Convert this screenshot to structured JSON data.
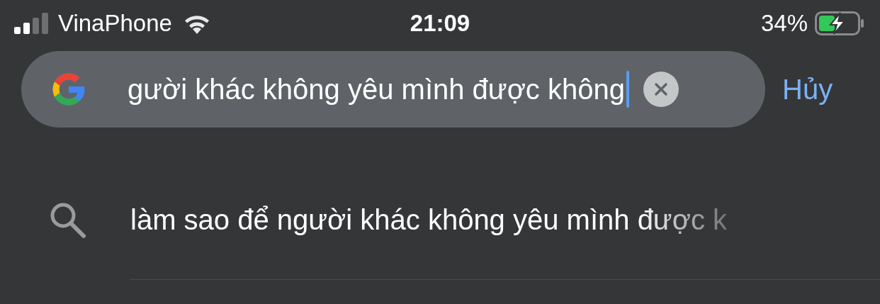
{
  "status_bar": {
    "carrier": "VinaPhone",
    "time": "21:09",
    "battery": "34%",
    "charging": true
  },
  "search": {
    "value": "gười khác không yêu mình được không",
    "cancel": "Hủy"
  },
  "suggestions": [
    {
      "text": "làm sao để người khác không yêu mình được k"
    }
  ]
}
